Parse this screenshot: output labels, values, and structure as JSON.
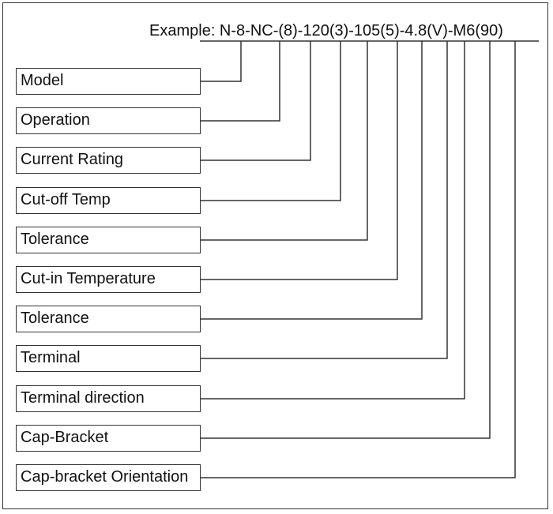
{
  "diagram": {
    "example_label": "Example: N-8-NC-(8)-120(3)-105(5)-4.8(V)-M6(90)",
    "fields": [
      {
        "label": "Model"
      },
      {
        "label": "Operation"
      },
      {
        "label": "Current Rating"
      },
      {
        "label": "Cut-off Temp"
      },
      {
        "label": "Tolerance"
      },
      {
        "label": "Cut-in Temperature"
      },
      {
        "label": "Tolerance"
      },
      {
        "label": "Terminal"
      },
      {
        "label": "Terminal direction"
      },
      {
        "label": "Cap-Bracket"
      },
      {
        "label": "Cap-bracket Orientation"
      }
    ]
  }
}
